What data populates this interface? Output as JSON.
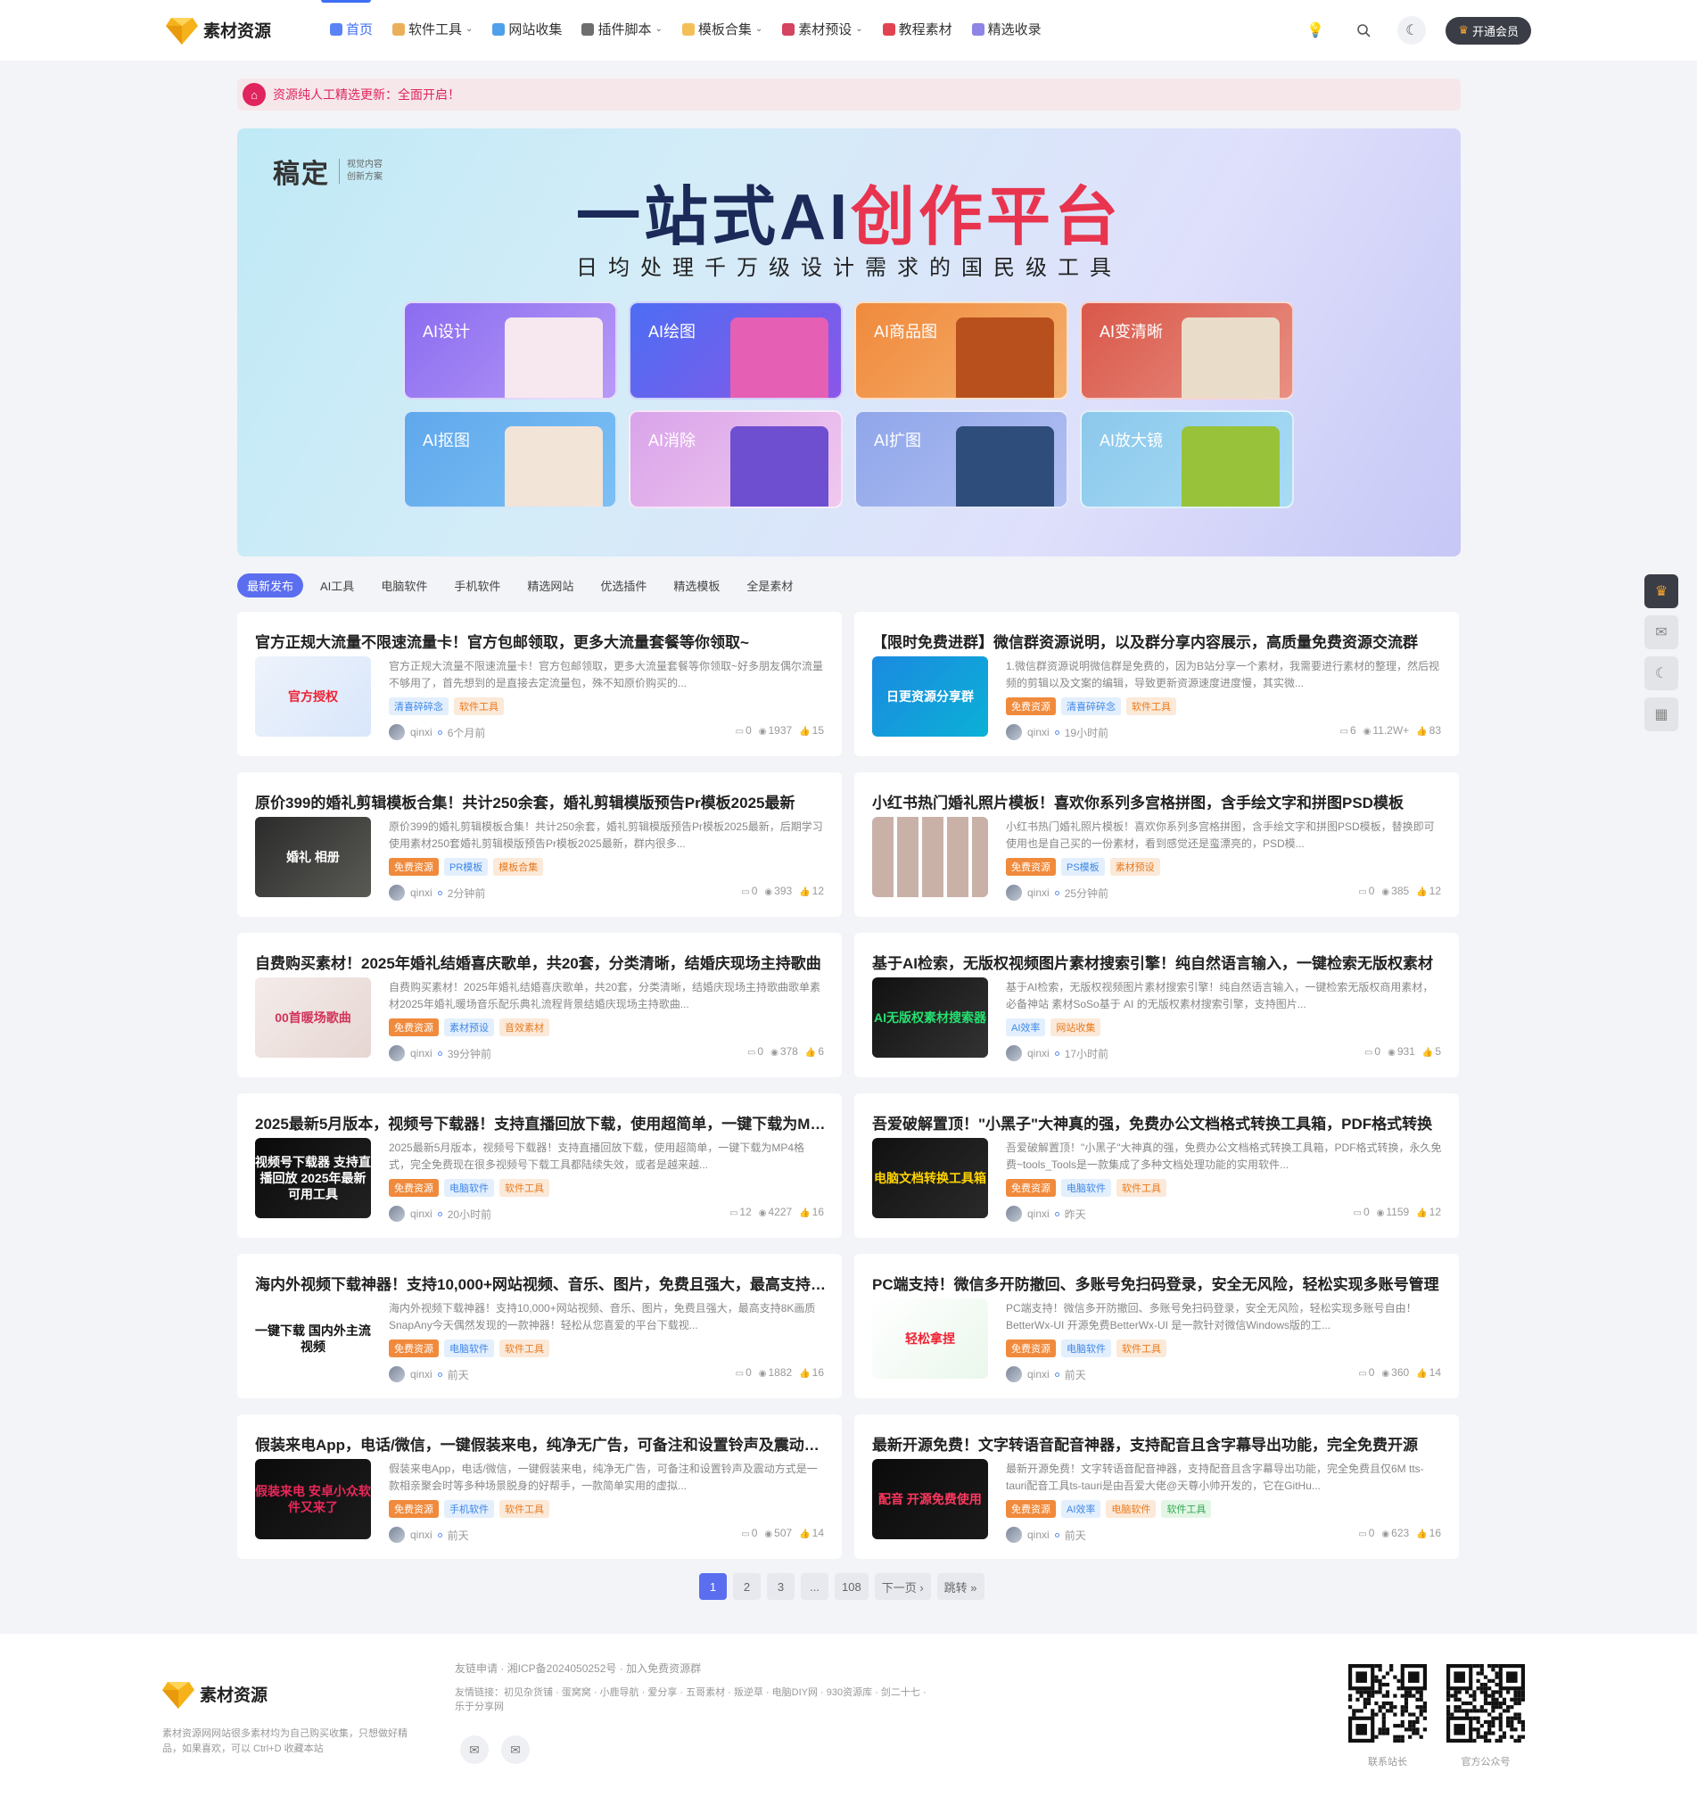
{
  "header": {
    "logo_text": "素材资源",
    "nav": [
      {
        "label": "首页",
        "active": true,
        "has_caret": false,
        "icon": "home-icon",
        "color": "#3f6df5"
      },
      {
        "label": "软件工具",
        "active": false,
        "has_caret": true,
        "icon": "grid-icon",
        "color": "#e6a23c"
      },
      {
        "label": "网站收集",
        "active": false,
        "has_caret": false,
        "icon": "edge-icon",
        "color": "#2f8fe8"
      },
      {
        "label": "插件脚本",
        "active": false,
        "has_caret": true,
        "icon": "paper-plane-icon",
        "color": "#555"
      },
      {
        "label": "模板合集",
        "active": false,
        "has_caret": true,
        "icon": "folder-icon",
        "color": "#f3b43b"
      },
      {
        "label": "素材预设",
        "active": false,
        "has_caret": true,
        "icon": "palette-icon",
        "color": "#c24"
      },
      {
        "label": "教程素材",
        "active": false,
        "has_caret": false,
        "icon": "a-circle-icon",
        "color": "#d23"
      },
      {
        "label": "精选收录",
        "active": false,
        "has_caret": false,
        "icon": "bookmark-icon",
        "color": "#7a6ee0"
      }
    ],
    "vip_label": "开通会员"
  },
  "notice": {
    "text": "资源纯人工精选更新：全面开启！"
  },
  "banner": {
    "brand_name": "稿定",
    "brand_sub_1": "视觉内容",
    "brand_sub_2": "创新方案",
    "headline_a": "一站式",
    "headline_b": "AI",
    "headline_c": "创作平台",
    "subline": "日均处理千万级设计需求的国民级工具",
    "cards": [
      {
        "label": "AI设计",
        "bg": "linear-gradient(135deg,#8b6cf0,#b79af7)",
        "deco": "#f6e8ee"
      },
      {
        "label": "AI绘图",
        "bg": "linear-gradient(135deg,#4d6df3,#8a57e8)",
        "deco": "#e55fb4"
      },
      {
        "label": "AI商品图",
        "bg": "linear-gradient(135deg,#f08a3c,#f4b06e)",
        "deco": "#b8501d"
      },
      {
        "label": "AI变清晰",
        "bg": "linear-gradient(135deg,#d9584a,#e88f82)",
        "deco": "#e9ddc9"
      },
      {
        "label": "AI抠图",
        "bg": "linear-gradient(135deg,#5fa8ec,#7cc0f4)",
        "deco": "#f3e4d8"
      },
      {
        "label": "AI消除",
        "bg": "linear-gradient(135deg,#d9a4ea,#f0c8ee)",
        "deco": "#6e4fd0"
      },
      {
        "label": "AI扩图",
        "bg": "linear-gradient(135deg,#8fa6ea,#b2c0f2)",
        "deco": "#2f4d7a"
      },
      {
        "label": "AI放大镜",
        "bg": "linear-gradient(135deg,#8cc8ec,#a8dcf4)",
        "deco": "#98c23a"
      }
    ]
  },
  "tabs": [
    "最新发布",
    "AI工具",
    "电脑软件",
    "手机软件",
    "精选网站",
    "优选插件",
    "精选模板",
    "全是素材"
  ],
  "posts": [
    {
      "title": "官方正规大流量不限速流量卡！官方包邮领取，更多大流量套餐等你领取~",
      "excerpt": "官方正规大流量不限速流量卡！官方包邮领取，更多大流量套餐等你领取~好多朋友偶尔流量不够用了，首先想到的是直接去定流量包，殊不知原价购买的...",
      "thumb_text": "官方授权",
      "thumb_bg": "linear-gradient(135deg,#eef3fb,#d8e6fb)",
      "thumb_color": "#e23",
      "tags": [
        {
          "t": "清喜碎碎念",
          "c": "blue"
        },
        {
          "t": "软件工具",
          "c": "orange"
        }
      ],
      "author": "qinxi",
      "time": "6个月前",
      "comments": "0",
      "views": "1937",
      "likes": "15"
    },
    {
      "title": "【限时免费进群】微信群资源说明，以及群分享内容展示，高质量免费资源交流群",
      "excerpt": "1.微信群资源说明微信群是免费的，因为B站分享一个素材，我需要进行素材的整理，然后视频的剪辑以及文案的编辑，导致更新资源速度进度慢，其实微...",
      "thumb_text": "日更资源分享群",
      "thumb_bg": "linear-gradient(135deg,#1b8ae0,#0bb0d6)",
      "thumb_color": "#fff",
      "tags": [
        {
          "t": "免费资源",
          "c": "solid"
        },
        {
          "t": "清喜碎碎念",
          "c": "blue"
        },
        {
          "t": "软件工具",
          "c": "orange"
        }
      ],
      "author": "qinxi",
      "time": "19小时前",
      "comments": "6",
      "views": "11.2W+",
      "likes": "83"
    },
    {
      "title": "原价399的婚礼剪辑模板合集！共计250余套，婚礼剪辑模版预告Pr模板2025最新",
      "excerpt": "原价399的婚礼剪辑模板合集！共计250余套，婚礼剪辑模版预告Pr模板2025最新，后期学习使用素材250套婚礼剪辑模版预告Pr模板2025最新，群内很多...",
      "thumb_text": "婚礼 相册",
      "thumb_bg": "linear-gradient(135deg,#2b2b2b,#5a5a55)",
      "thumb_color": "#fff",
      "tags": [
        {
          "t": "免费资源",
          "c": "solid"
        },
        {
          "t": "PR模板",
          "c": "blue"
        },
        {
          "t": "模板合集",
          "c": "orange"
        }
      ],
      "author": "qinxi",
      "time": "2分钟前",
      "comments": "0",
      "views": "393",
      "likes": "12"
    },
    {
      "title": "小红书热门婚礼照片模板！喜欢你系列多宫格拼图，含手绘文字和拼图PSD模板",
      "excerpt": "小红书热门婚礼照片模板！喜欢你系列多宫格拼图，含手绘文字和拼图PSD模板，替换即可使用也是自己买的一份素材，看到感觉还是蛮漂亮的，PSD模...",
      "thumb_text": "",
      "thumb_bg": "repeating-linear-gradient(90deg,#c9b1a8 0 24px,#fff 24px 28px),#c9b1a8",
      "thumb_color": "#fff",
      "tags": [
        {
          "t": "免费资源",
          "c": "solid"
        },
        {
          "t": "PS模板",
          "c": "blue"
        },
        {
          "t": "素材预设",
          "c": "orange"
        }
      ],
      "author": "qinxi",
      "time": "25分钟前",
      "comments": "0",
      "views": "385",
      "likes": "12"
    },
    {
      "title": "自费购买素材！2025年婚礼结婚喜庆歌单，共20套，分类清晰，结婚庆现场主持歌曲",
      "excerpt": "自费购买素材！2025年婚礼结婚喜庆歌单，共20套，分类清晰，结婚庆现场主持歌曲歌单素材2025年婚礼暖场音乐配乐典礼流程背景结婚庆现场主持歌曲...",
      "thumb_text": "00首暖场歌曲",
      "thumb_bg": "linear-gradient(135deg,#f4ecea,#e6d6d2)",
      "thumb_color": "#d2335a",
      "tags": [
        {
          "t": "免费资源",
          "c": "solid"
        },
        {
          "t": "素材预设",
          "c": "blue"
        },
        {
          "t": "音效素材",
          "c": "orange"
        }
      ],
      "author": "qinxi",
      "time": "39分钟前",
      "comments": "0",
      "views": "378",
      "likes": "6"
    },
    {
      "title": "基于AI检索，无版权视频图片素材搜索引擎！纯自然语言输入，一键检索无版权素材",
      "excerpt": "基于AI检索，无版权视频图片素材搜索引擎！纯自然语言输入，一键检索无版权商用素材，必备神站 素材SoSo基于 AI 的无版权素材搜索引擎，支持图片...",
      "thumb_text": "AI无版权素材搜索器",
      "thumb_bg": "linear-gradient(135deg,#111,#333)",
      "thumb_color": "#25e070",
      "tags": [
        {
          "t": "AI效率",
          "c": "blue"
        },
        {
          "t": "网站收集",
          "c": "orange"
        }
      ],
      "author": "qinxi",
      "time": "17小时前",
      "comments": "0",
      "views": "931",
      "likes": "5"
    },
    {
      "title": "2025最新5月版本，视频号下载器！支持直播回放下载，使用超简单，一键下载为MP4",
      "excerpt": "2025最新5月版本，视频号下载器！支持直播回放下载，使用超简单，一键下载为MP4格式，完全免费现在很多视频号下载工具都陆续失效，或者是越来越...",
      "thumb_text": "视频号下载器 支持直播回放 2025年最新可用工具",
      "thumb_bg": "linear-gradient(135deg,#0a0a0a,#222)",
      "thumb_color": "#fff",
      "tags": [
        {
          "t": "免费资源",
          "c": "solid"
        },
        {
          "t": "电脑软件",
          "c": "blue"
        },
        {
          "t": "软件工具",
          "c": "orange"
        }
      ],
      "author": "qinxi",
      "time": "20小时前",
      "comments": "12",
      "views": "4227",
      "likes": "16"
    },
    {
      "title": "吾爱破解置顶！\"小黑子\"大神真的强，免费办公文档格式转换工具箱，PDF格式转换",
      "excerpt": "吾爱破解置顶！\"小黑子\"大神真的强，免费办公文档格式转换工具箱，PDF格式转换，永久免费~tools_Tools是一款集成了多种文档处理功能的实用软件...",
      "thumb_text": "电脑文档转换工具箱",
      "thumb_bg": "linear-gradient(135deg,#111,#2a2a2a)",
      "thumb_color": "#ffd400",
      "tags": [
        {
          "t": "免费资源",
          "c": "solid"
        },
        {
          "t": "电脑软件",
          "c": "blue"
        },
        {
          "t": "软件工具",
          "c": "orange"
        }
      ],
      "author": "qinxi",
      "time": "昨天",
      "comments": "0",
      "views": "1159",
      "likes": "12"
    },
    {
      "title": "海内外视频下载神器！支持10,000+网站视频、音乐、图片，免费且强大，最高支持8K",
      "excerpt": "海内外视频下载神器！支持10,000+网站视频、音乐、图片，免费且强大，最高支持8K画质 SnapAny今天偶然发现的一款神器！轻松从您喜爱的平台下载视...",
      "thumb_text": "一键下载 国内外主流视频",
      "thumb_bg": "#ffffff",
      "thumb_color": "#111",
      "tags": [
        {
          "t": "免费资源",
          "c": "solid"
        },
        {
          "t": "电脑软件",
          "c": "blue"
        },
        {
          "t": "软件工具",
          "c": "orange"
        }
      ],
      "author": "qinxi",
      "time": "前天",
      "comments": "0",
      "views": "1882",
      "likes": "16"
    },
    {
      "title": "PC端支持！微信多开防撤回、多账号免扫码登录，安全无风险，轻松实现多账号管理",
      "excerpt": "PC端支持！微信多开防撤回、多账号免扫码登录，安全无风险，轻松实现多账号自由！BetterWx-UI 开源免费BetterWx-UI 是一款针对微信Windows版的工...",
      "thumb_text": "轻松拿捏",
      "thumb_bg": "linear-gradient(135deg,#ffffff,#eaf7ec)",
      "thumb_color": "#e23",
      "tags": [
        {
          "t": "免费资源",
          "c": "solid"
        },
        {
          "t": "电脑软件",
          "c": "blue"
        },
        {
          "t": "软件工具",
          "c": "orange"
        }
      ],
      "author": "qinxi",
      "time": "前天",
      "comments": "0",
      "views": "360",
      "likes": "14"
    },
    {
      "title": "假装来电App，电话/微信，一键假装来电，纯净无广告，可备注和设置铃声及震动方式",
      "excerpt": "假装来电App，电话/微信，一键假装来电，纯净无广告，可备注和设置铃声及震动方式是一款相亲聚会时等多种场景脱身的好帮手，一款简单实用的虚拟...",
      "thumb_text": "假装来电 安卓小众软件又来了",
      "thumb_bg": "linear-gradient(135deg,#0b0b0b,#1c1c1c)",
      "thumb_color": "#e8285a",
      "tags": [
        {
          "t": "免费资源",
          "c": "solid"
        },
        {
          "t": "手机软件",
          "c": "blue"
        },
        {
          "t": "软件工具",
          "c": "orange"
        }
      ],
      "author": "qinxi",
      "time": "前天",
      "comments": "0",
      "views": "507",
      "likes": "14"
    },
    {
      "title": "最新开源免费！文字转语音配音神器，支持配音且含字幕导出功能，完全免费开源",
      "excerpt": "最新开源免费！文字转语音配音神器，支持配音且含字幕导出功能，完全免费且仅6M tts-tauri配音工具ts-tauri是由吾爱大佬@天尊小帅开发的，它在GitHu...",
      "thumb_text": "配音 开源免费使用",
      "thumb_bg": "linear-gradient(135deg,#0b0b0b,#1a1a1a)",
      "thumb_color": "#ff3860",
      "tags": [
        {
          "t": "免费资源",
          "c": "solid"
        },
        {
          "t": "AI效率",
          "c": "blue"
        },
        {
          "t": "电脑软件",
          "c": "orange"
        },
        {
          "t": "软件工具",
          "c": "green"
        }
      ],
      "author": "qinxi",
      "time": "前天",
      "comments": "0",
      "views": "623",
      "likes": "16"
    }
  ],
  "pagination": {
    "pages": [
      "1",
      "2",
      "3",
      "...",
      "108"
    ],
    "next": "下一页 ›",
    "jump": "跳转 »"
  },
  "footer": {
    "logo_text": "素材资源",
    "desc": "素材资源网网站很多素材均为自己购买收集，只想做好精品，如果喜欢，可以 Ctrl+D 收藏本站",
    "links": "友链申请 · 湘ICP备2024050252号 · 加入免费资源群",
    "friends": "友情链接：初见杂货铺 · 蛋窝窝 · 小鹿导航 · 爱分享 · 五哥素材 · 叛逆草 · 电脑DIY网 · 930资源库 · 剑二十七 · 乐于分享网",
    "qr1_label": "联系站长",
    "qr2_label": "官方公众号"
  }
}
